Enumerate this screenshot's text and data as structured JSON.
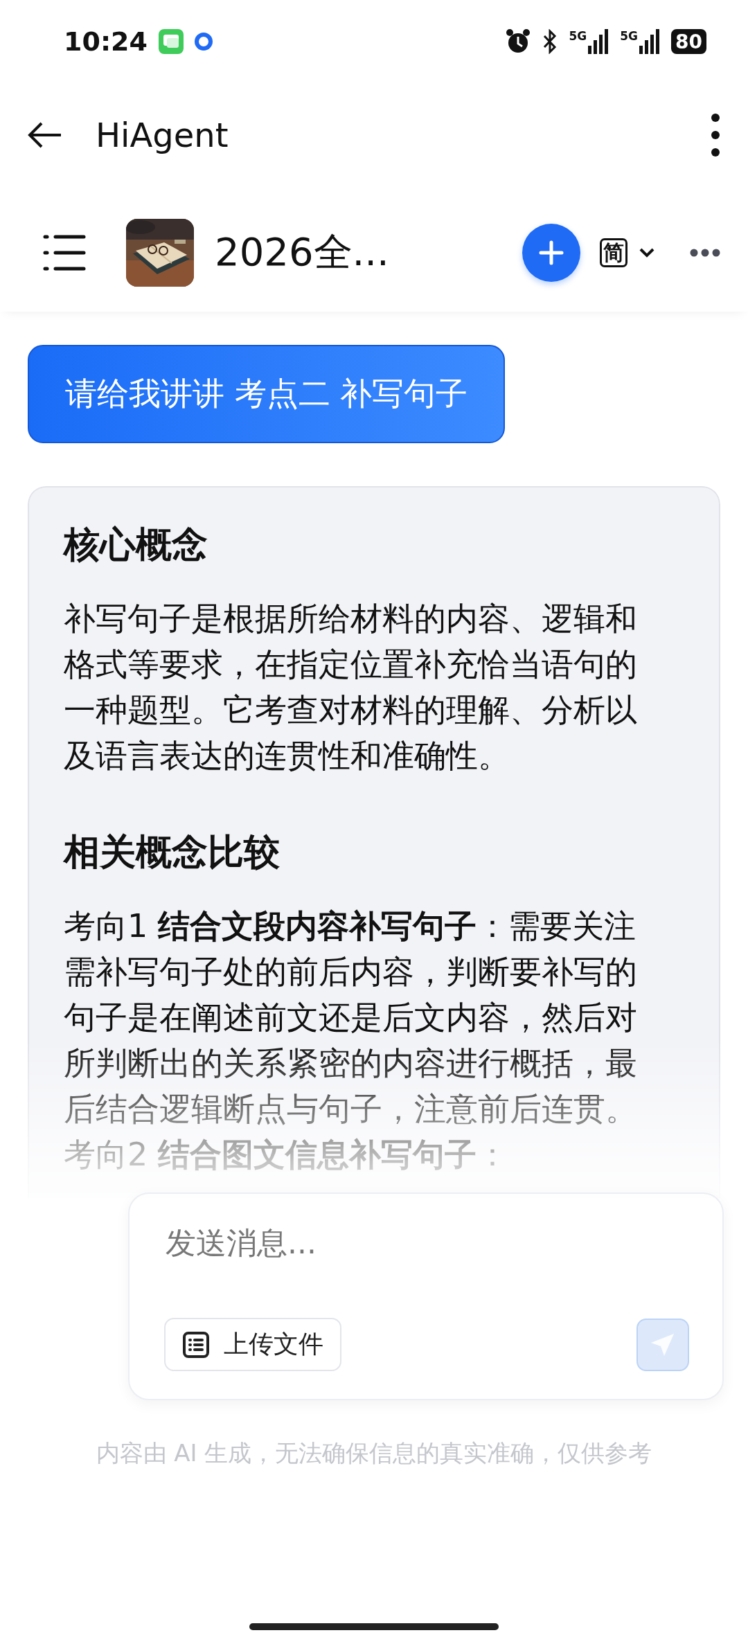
{
  "status_bar": {
    "time": "10:24",
    "signal_labels": [
      "5G",
      "5G"
    ],
    "battery": "80"
  },
  "app_bar": {
    "title": "HiAgent"
  },
  "chat_header": {
    "title": "2026全...",
    "language": "简"
  },
  "messages": [
    {
      "kind": "user",
      "text": "请给我讲讲 考点二 补写句子"
    },
    {
      "kind": "assistant",
      "blocks": [
        {
          "kind": "heading",
          "text": "核心概念"
        },
        {
          "kind": "paragraph",
          "text": "补写句子是根据所给材料的内容、逻辑和格式等要求，在指定位置补充恰当语句的一种题型。它考查对材料的理解、分析以及语言表达的连贯性和准确性。"
        },
        {
          "kind": "heading",
          "text": "相关概念比较"
        },
        {
          "kind": "paragraph",
          "text": "考向1 **结合文段内容补写句子**：需要关注需补写句子处的前后内容，判断要补写的句子是在阐述前文还是后文内容，然后对所判断出的关系紧密的内容进行概括，最后结合逻辑断点与句子，注意前后连贯。"
        },
        {
          "kind": "paragraph",
          "text": "考向2 **结合图文信息补写句子**："
        }
      ]
    }
  ],
  "composer": {
    "placeholder": "发送消息...",
    "upload_label": "上传文件",
    "send_disabled": true
  },
  "disclaimer": "内容由 AI 生成，无法确保信息的真实准确，仅供参考"
}
